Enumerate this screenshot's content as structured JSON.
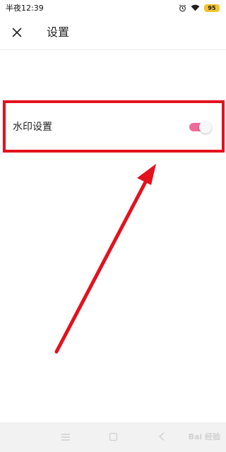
{
  "status_bar": {
    "time": "半夜12:39",
    "battery": "95",
    "icons": [
      "alarm-icon",
      "wifi-icon",
      "battery-icon"
    ]
  },
  "header": {
    "close_icon": "close-icon",
    "title": "设置"
  },
  "settings": {
    "watermark": {
      "label": "水印设置",
      "enabled": true,
      "toggle_color": "#f06a9a"
    }
  },
  "annotation": {
    "color": "#e4121d",
    "shapes": [
      "highlight-box",
      "pointer-arrow"
    ]
  },
  "nav_bar": {
    "buttons": [
      "menu-icon",
      "home-icon",
      "back-icon"
    ],
    "watermark_text": "Bai 经验"
  }
}
